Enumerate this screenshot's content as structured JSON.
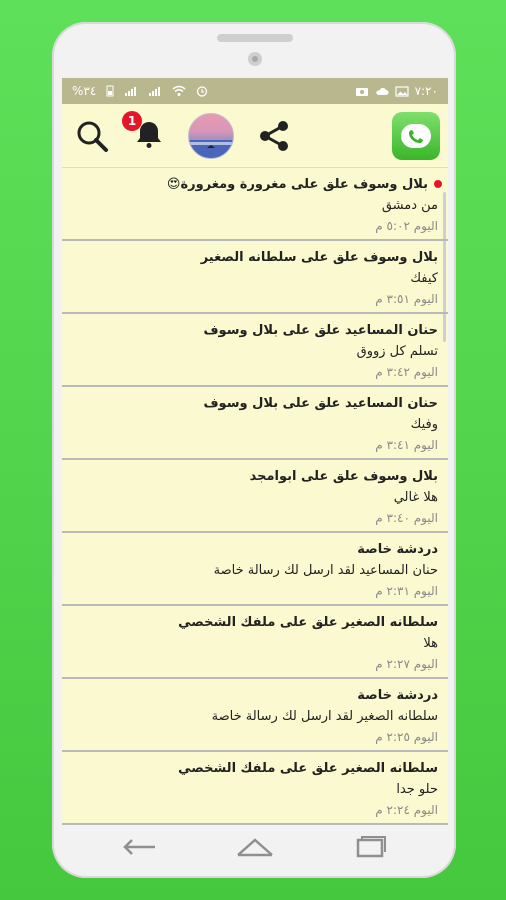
{
  "status": {
    "time": "٧:٢٠",
    "battery": "%٣٤"
  },
  "feed": [
    {
      "title": "بلال وسوف علق على مغرورة ومغرورة😍",
      "text": "من دمشق",
      "time": "اليوم ٥:٠٢ م",
      "unread": true
    },
    {
      "title": "بلال وسوف علق على سلطانه الصغير",
      "text": "كيفك",
      "time": "اليوم ٣:٥١ م",
      "unread": false
    },
    {
      "title": "حنان المساعيد علق على بلال وسوف",
      "text": "تسلم كل زووق",
      "time": "اليوم ٣:٤٢ م",
      "unread": false
    },
    {
      "title": "حنان المساعيد علق على بلال وسوف",
      "text": "وفيك",
      "time": "اليوم ٣:٤١ م",
      "unread": false
    },
    {
      "title": "بلال وسوف علق على ابوامجد",
      "text": "هلا غالي",
      "time": "اليوم ٣:٤٠ م",
      "unread": false
    },
    {
      "title": "دردشة خاصة",
      "text": "حنان المساعيد لقد ارسل لك رسالة خاصة",
      "time": "اليوم ٢:٣١ م",
      "unread": false
    },
    {
      "title": "سلطانه الصغير علق على ملفك الشخصي",
      "text": "هلا",
      "time": "اليوم ٢:٢٧ م",
      "unread": false
    },
    {
      "title": "دردشة خاصة",
      "text": "سلطانه الصغير لقد ارسل لك رسالة خاصة",
      "time": "اليوم ٢:٢٥ م",
      "unread": false
    },
    {
      "title": "سلطانه الصغير علق على ملفك الشخصي",
      "text": "حلو جدا",
      "time": "اليوم ٢:٢٤ م",
      "unread": false
    }
  ],
  "notifications": {
    "badge": "1"
  },
  "icons": {
    "search": "search-icon",
    "bell": "bell-icon",
    "share": "share-icon",
    "logo": "chat-phone-logo",
    "back": "back-icon",
    "home": "home-icon",
    "recents": "recents-icon"
  },
  "colors": {
    "background": "#fbf9cf",
    "statusbar": "#b9b78e",
    "badge": "#e3162a",
    "brand": "#3ab52a"
  }
}
